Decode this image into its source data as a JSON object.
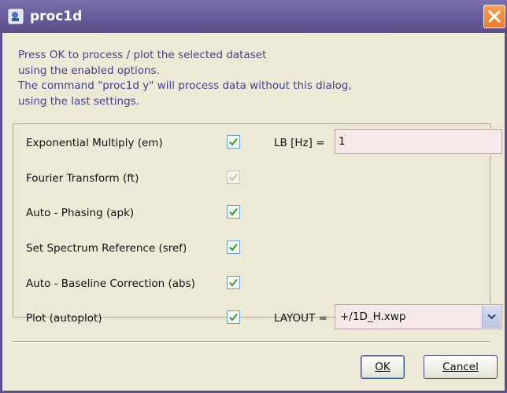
{
  "window": {
    "title": "proc1d",
    "close_icon": "close-icon"
  },
  "intro": {
    "lines": [
      "Press OK to process / plot the selected dataset",
      "using the enabled options.",
      "The command \"proc1d y\" will process data without this dialog,",
      "using the last settings."
    ]
  },
  "options": [
    {
      "label": "Exponential Multiply (em)",
      "checked": true,
      "enabled": true
    },
    {
      "label": "Fourier Transform (ft)",
      "checked": true,
      "enabled": false
    },
    {
      "label": "Auto - Phasing (apk)",
      "checked": true,
      "enabled": true
    },
    {
      "label": "Set Spectrum Reference (sref)",
      "checked": true,
      "enabled": true
    },
    {
      "label": "Auto - Baseline Correction (abs)",
      "checked": true,
      "enabled": true
    },
    {
      "label": "Plot (autoplot)",
      "checked": true,
      "enabled": true
    }
  ],
  "lb": {
    "label": "LB [Hz] =",
    "value": "1"
  },
  "layout": {
    "label": "LAYOUT =",
    "value": "+/1D_H.xwp"
  },
  "buttons": {
    "ok": "OK",
    "cancel": "Cancel"
  },
  "colors": {
    "titlebar": "#665a99",
    "dialog_bg": "#ecead6",
    "intro_text": "#45418f",
    "field_bg": "#f6e8e8",
    "check_green": "#2f9a3a"
  }
}
